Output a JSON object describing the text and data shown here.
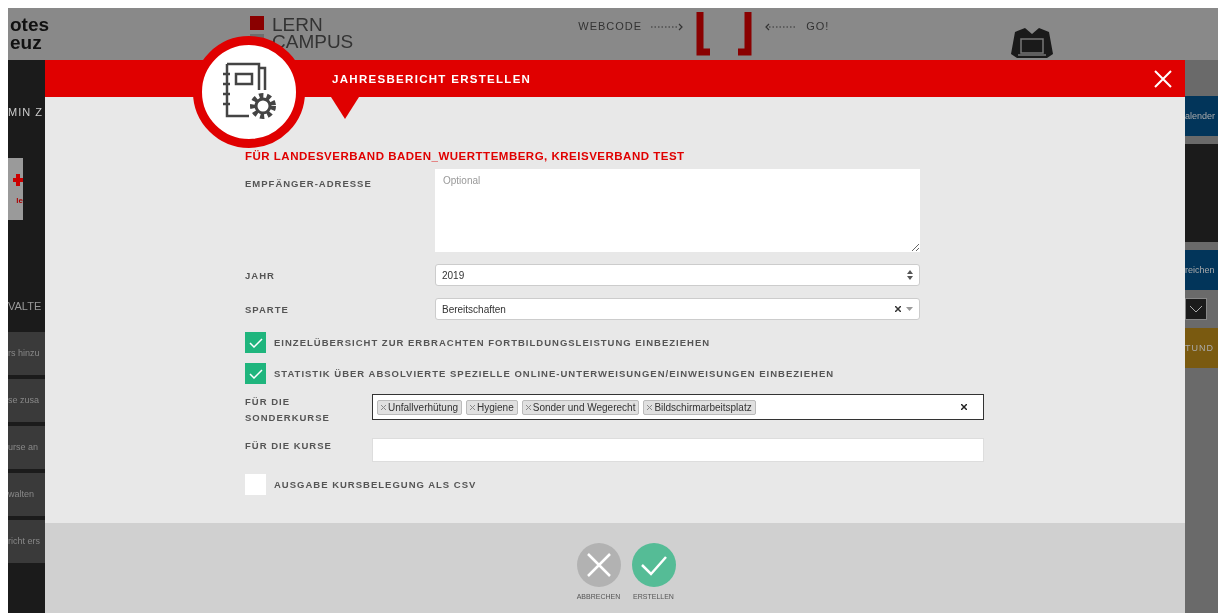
{
  "background": {
    "logo_lines": [
      "otes",
      "euz"
    ],
    "campus_lines": [
      "LERN",
      "CAMPUS"
    ],
    "webcode": {
      "label": "WEBCODE",
      "go": "GO!"
    },
    "left_sidebar": {
      "heading": "MIN Z",
      "card_text": "le",
      "section": "VALTE",
      "items": [
        "rs hinzu",
        "se zusa",
        "urse an",
        "walten",
        "richt ers"
      ]
    },
    "right_sidebar": {
      "items": [
        {
          "kind": "blue",
          "label": "alender"
        },
        {
          "kind": "dark"
        },
        {
          "kind": "blue",
          "label": "reichen"
        },
        {
          "kind": "dropdown"
        },
        {
          "kind": "gold",
          "label": "TUND"
        }
      ]
    }
  },
  "modal": {
    "title": "JAHRESBERICHT ERSTELLEN",
    "subtitle": "FÜR LANDESVERBAND BADEN_WUERTTEMBERG, KREISVERBAND TEST",
    "fields": [
      {
        "kind": "textarea",
        "label": "EMPFÄNGER-ADRESSE",
        "placeholder": "Optional"
      },
      {
        "kind": "spinner",
        "label": "JAHR",
        "value": "2019"
      },
      {
        "kind": "select",
        "label": "SPARTE",
        "value": "Bereitschaften"
      },
      {
        "kind": "checkbox",
        "label": "EINZELÜBERSICHT ZUR ERBRACHTEN FORTBILDUNGSLEISTUNG EINBEZIEHEN",
        "checked": true
      },
      {
        "kind": "checkbox",
        "label": "STATISTIK ÜBER ABSOLVIERTE SPEZIELLE ONLINE-UNTERWEISUNGEN/EINWEISUNGEN EINBEZIEHEN",
        "checked": true
      },
      {
        "kind": "tags",
        "label": "FÜR DIE SONDERKURSE",
        "tags": [
          "Unfallverhütung",
          "Hygiene",
          "Sonder und Wegerecht",
          "Bildschirmarbeitsplatz"
        ]
      },
      {
        "kind": "text",
        "label": "FÜR DIE KURSE"
      },
      {
        "kind": "checkbox",
        "label": "AUSGABE KURSBELEGUNG ALS CSV",
        "checked": false
      }
    ],
    "buttons": [
      {
        "kind": "cancel",
        "label": "ABBRECHEN"
      },
      {
        "kind": "confirm",
        "label": "ERSTELLEN"
      }
    ]
  }
}
